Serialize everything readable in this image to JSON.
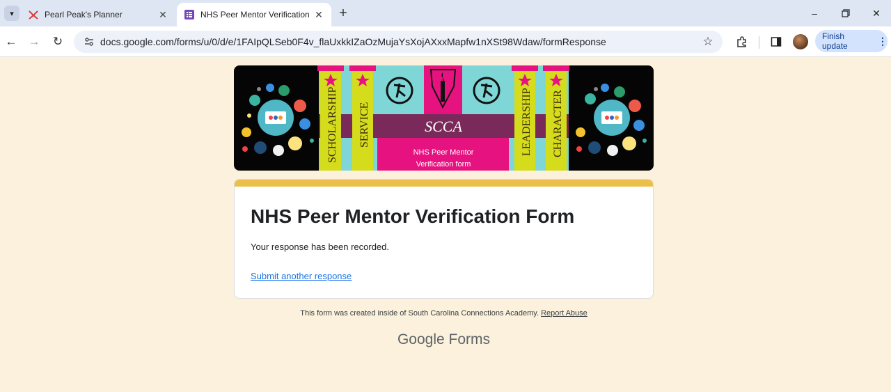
{
  "browser": {
    "tabs": [
      {
        "title": "Pearl Peak's Planner",
        "active": false
      },
      {
        "title": "NHS Peer Mentor Verification F",
        "active": true
      }
    ],
    "url": "docs.google.com/forms/u/0/d/e/1FAIpQLSeb0F4v_flaUxkkIZaOzMujaYsXojAXxxMapfw1nXSt98Wdaw/formResponse",
    "finish_update_label": "Finish update",
    "colors": {
      "tabstrip": "#dfe6f3",
      "finish_button": "#d3e3fd",
      "forms_accent": "#7248b9"
    }
  },
  "banner": {
    "pillars_left": [
      "SCHOLARSHIP",
      "SERVICE"
    ],
    "pillars_right": [
      "LEADERSHIP",
      "CHARACTER"
    ],
    "emblem_text": "SCCA",
    "caption_line1": "NHS Peer Mentor",
    "caption_line2": "Verification form",
    "colors": {
      "teal": "#7fd6d6",
      "magenta": "#e6127f",
      "purple": "#7a2a5a",
      "pillar": "#d5dc1c",
      "background": "#050505"
    }
  },
  "form": {
    "title": "NHS Peer Mentor Verification Form",
    "confirmation": "Your response has been recorded.",
    "submit_another": "Submit another response",
    "accent_color": "#ebbf4a"
  },
  "footer": {
    "created_text": "This form was created inside of South Carolina Connections Academy.",
    "report_abuse": "Report Abuse",
    "brand_google": "Google",
    "brand_forms": "Forms"
  }
}
